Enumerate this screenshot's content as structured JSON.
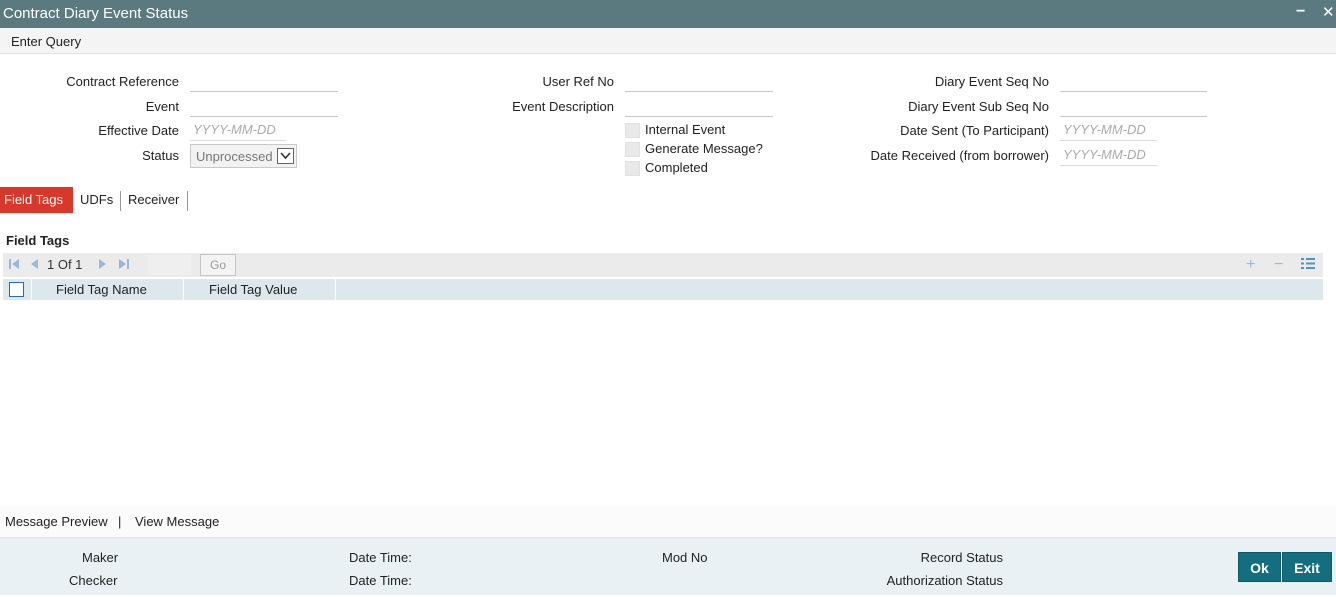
{
  "window": {
    "title": "Contract Diary Event Status",
    "minimize": "−",
    "close": "✕"
  },
  "menu": {
    "enter_query": "Enter Query"
  },
  "form": {
    "contract_reference": {
      "label": "Contract Reference",
      "value": ""
    },
    "event": {
      "label": "Event",
      "value": ""
    },
    "effective_date": {
      "label": "Effective Date",
      "placeholder": "YYYY-MM-DD"
    },
    "status": {
      "label": "Status",
      "value": "Unprocessed"
    },
    "user_ref_no": {
      "label": "User Ref No",
      "value": ""
    },
    "event_description": {
      "label": "Event Description",
      "value": ""
    },
    "internal_event": {
      "label": "Internal Event",
      "checked": false
    },
    "generate_message": {
      "label": "Generate Message?",
      "checked": false
    },
    "completed": {
      "label": "Completed",
      "checked": false
    },
    "diary_event_seq_no": {
      "label": "Diary Event Seq No",
      "value": ""
    },
    "diary_event_sub_seq_no": {
      "label": "Diary Event Sub Seq No",
      "value": ""
    },
    "date_sent": {
      "label": "Date Sent (To Participant)",
      "placeholder": "YYYY-MM-DD"
    },
    "date_received": {
      "label": "Date Received (from borrower)",
      "placeholder": "YYYY-MM-DD"
    }
  },
  "tabs": [
    {
      "label": "Field Tags",
      "active": true
    },
    {
      "label": "UDFs",
      "active": false
    },
    {
      "label": "Receiver",
      "active": false
    }
  ],
  "field_tags": {
    "section_title": "Field Tags",
    "pager": "1 Of 1",
    "go_label": "Go",
    "columns": [
      "Field Tag Name",
      "Field Tag Value"
    ],
    "rows": []
  },
  "bottom_links": {
    "message_preview": "Message Preview",
    "separator": "|",
    "view_message": "View Message"
  },
  "footer": {
    "maker": "Maker",
    "checker": "Checker",
    "date_time_1": "Date Time:",
    "date_time_2": "Date Time:",
    "mod_no": "Mod No",
    "record_status": "Record Status",
    "authorization_status": "Authorization Status",
    "ok": "Ok",
    "exit": "Exit"
  },
  "colors": {
    "title_bar": "#5b7a80",
    "active_tab": "#d9372a",
    "primary_button": "#156e80",
    "grid_header": "#dde8ec",
    "footer": "#e9f1f4"
  }
}
